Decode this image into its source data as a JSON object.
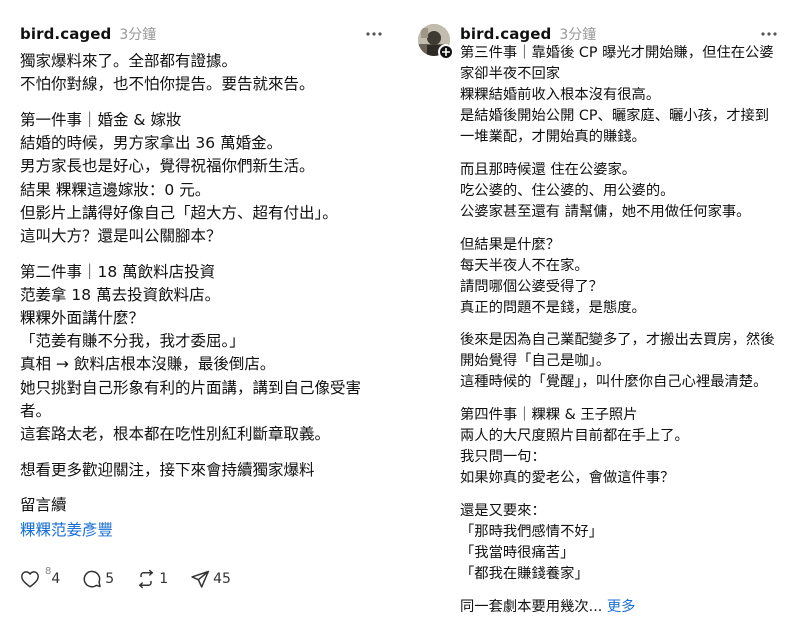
{
  "left_post": {
    "username": "bird.caged",
    "timestamp": "3分鐘",
    "lines": [
      "獨家爆料來了。全部都有證據。",
      "不怕你對線，也不怕你提告。要告就來告。",
      "第一件事｜婚金 & 嫁妝",
      "結婚的時候，男方家拿出 36 萬婚金。",
      "男方家長也是好心，覺得祝福你們新生活。",
      "結果 粿粿這邊嫁妝：0 元。",
      "但影片上講得好像自己「超大方、超有付出」。",
      "這叫大方？還是叫公關腳本？",
      "第二件事｜18 萬飲料店投資",
      "范姜拿 18 萬去投資飲料店。",
      "粿粿外面講什麼？",
      "「范姜有賺不分我，我才委屈。」",
      "真相 → 飲料店根本沒賺，最後倒店。",
      "她只挑對自己形象有利的片面講，講到自己像受害者。",
      "這套路太老，根本都在吃性別紅利斷章取義。",
      "想看更多歡迎關注，接下來會持續獨家爆料",
      "留言續"
    ],
    "hashtag_link": "粿粿范姜彥豐",
    "actions": {
      "like_sup": "8",
      "like_count": "4",
      "reply_count": "5",
      "repost_count": "1",
      "share_count": "45"
    }
  },
  "right_post": {
    "username": "bird.caged",
    "timestamp": "3分鐘",
    "lines": [
      "第三件事｜靠婚後 CP 曝光才開始賺，但住在公婆",
      "家卻半夜不回家",
      "粿粿結婚前收入根本沒有很高。",
      "是結婚後開始公開 CP、曬家庭、曬小孩，才接到",
      "一堆業配，才開始真的賺錢。",
      "而且那時候還 住在公婆家。",
      "吃公婆的、住公婆的、用公婆的。",
      "公婆家甚至還有 請幫傭，她不用做任何家事。",
      "但結果是什麼？",
      "每天半夜人不在家。",
      "請問哪個公婆受得了？",
      "真正的問題不是錢，是態度。",
      "後來是因為自己業配變多了，才搬出去買房，然後",
      "開始覺得「自己是咖」。",
      "這種時候的「覺醒」，叫什麼你自己心裡最清楚。",
      "第四件事｜粿粿 & 王子照片",
      "兩人的大尺度照片目前都在手上了。",
      "我只問一句：",
      "如果妳真的愛老公，會做這件事？",
      "還是又要來：",
      "「那時我們感情不好」",
      "「我當時很痛苦」",
      "「都我在賺錢養家」",
      "同一套劇本要用幾次..."
    ],
    "more_label": "更多"
  },
  "colors": {
    "text": "#111111",
    "muted": "#999999",
    "link": "#1a6fd4"
  }
}
